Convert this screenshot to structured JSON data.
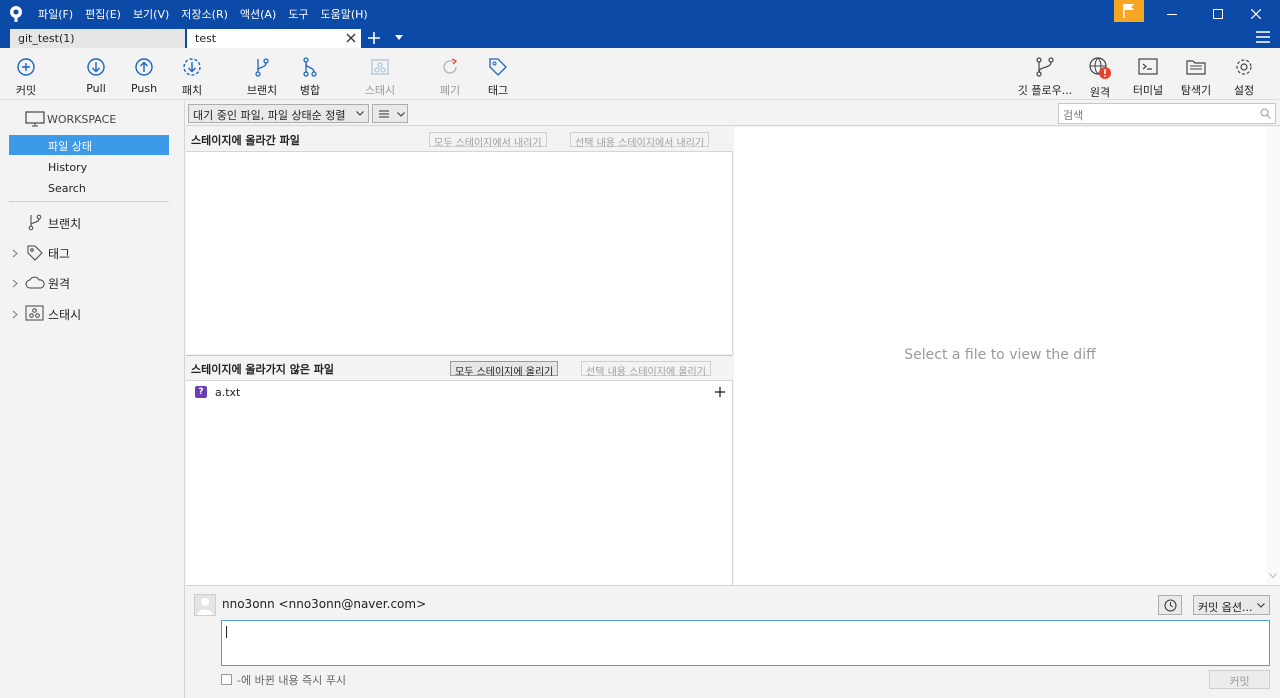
{
  "menu": [
    "파일(F)",
    "편집(E)",
    "보기(V)",
    "저장소(R)",
    "액션(A)",
    "도구",
    "도움말(H)"
  ],
  "tabs": {
    "inactive": "git_test(1)",
    "active": "test"
  },
  "toolbar": {
    "commit": "커밋",
    "pull": "Pull",
    "push": "Push",
    "fetch": "패치",
    "branch": "브랜치",
    "merge": "병합",
    "stash": "스태시",
    "discard": "폐기",
    "tag": "태그",
    "gitflow": "깃 플로우...",
    "remote": "원격",
    "terminal": "터미널",
    "explorer": "탐색기",
    "settings": "설정"
  },
  "sidebar": {
    "workspace": "WORKSPACE",
    "file_status": "파일 상태",
    "history": "History",
    "search": "Search",
    "branches": "브랜치",
    "tags": "태그",
    "remotes": "원격",
    "stashes": "스태시"
  },
  "filter": {
    "mode": "대기 중인 파일, 파일 상태순 정렬",
    "search_placeholder": "검색"
  },
  "staged": {
    "title": "스테이지에 올라간 파일",
    "unstage_all": "모두 스테이지에서 내리기",
    "unstage_selected": "선택 내용 스테이지에서 내리기"
  },
  "unstaged": {
    "title": "스테이지에 올라가지 않은 파일",
    "stage_all": "모두 스테이지에 올리기",
    "stage_selected": "선택 내용 스테이지에 올리기",
    "files": [
      {
        "name": "a.txt",
        "status": "?"
      }
    ]
  },
  "diff": {
    "placeholder": "Select a file to view the diff"
  },
  "commit": {
    "author": "nno3onn <nno3onn@naver.com>",
    "options": "커밋 옵션...",
    "push_immediately": "-에 바뀐 내용 즉시 푸시",
    "commit_button": "커밋"
  },
  "colors": {
    "titlebar": "#0b4aa6",
    "selection": "#3d9ae8",
    "flag": "#f5a623",
    "alert": "#e8412c"
  }
}
